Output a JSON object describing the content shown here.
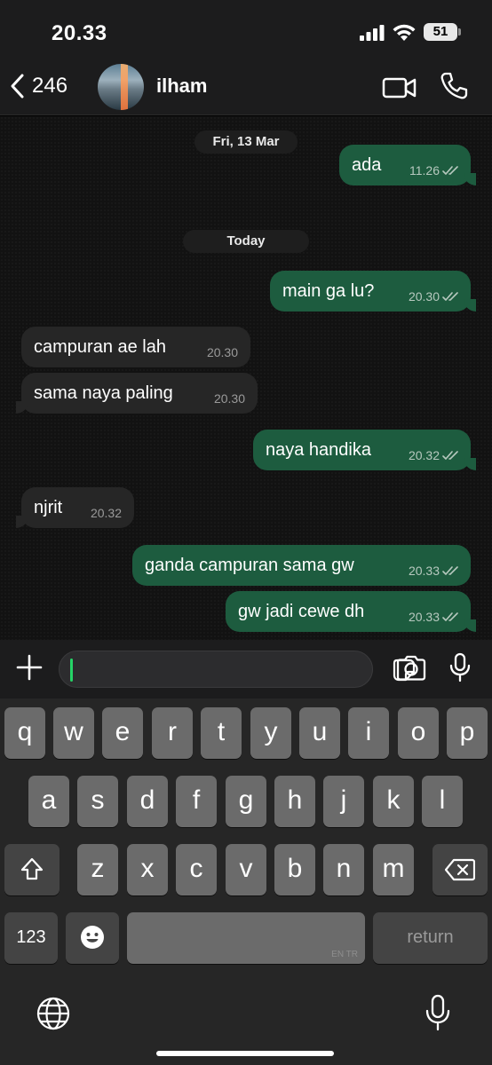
{
  "status_bar": {
    "time": "20.33",
    "battery": "51"
  },
  "header": {
    "back_count": "246",
    "contact_name": "ilham"
  },
  "chat": {
    "date_1": "Fri, 13 Mar",
    "date_2": "Today",
    "messages": [
      {
        "direction": "out",
        "text": "ada",
        "time": "11.26"
      },
      {
        "direction": "out",
        "text": "main ga lu?",
        "time": "20.30"
      },
      {
        "direction": "in",
        "text": "campuran ae lah",
        "time": "20.30"
      },
      {
        "direction": "in",
        "text": "sama naya paling",
        "time": "20.30"
      },
      {
        "direction": "out",
        "text": "naya handika",
        "time": "20.32"
      },
      {
        "direction": "in",
        "text": "njrit",
        "time": "20.32"
      },
      {
        "direction": "out",
        "text": "ganda campuran sama gw",
        "time": "20.33"
      },
      {
        "direction": "out",
        "text": "gw jadi cewe dh",
        "time": "20.33"
      }
    ]
  },
  "keyboard": {
    "row1": [
      "q",
      "w",
      "e",
      "r",
      "t",
      "y",
      "u",
      "i",
      "o",
      "p"
    ],
    "row2": [
      "a",
      "s",
      "d",
      "f",
      "g",
      "h",
      "j",
      "k",
      "l"
    ],
    "row3": [
      "z",
      "x",
      "c",
      "v",
      "b",
      "n",
      "m"
    ],
    "numbers_key": "123",
    "return_key": "return",
    "language_tag": "EN TR"
  },
  "colors": {
    "outgoing_bubble": "#1d5c3f",
    "incoming_bubble": "#262626",
    "accent": "#25d366"
  }
}
